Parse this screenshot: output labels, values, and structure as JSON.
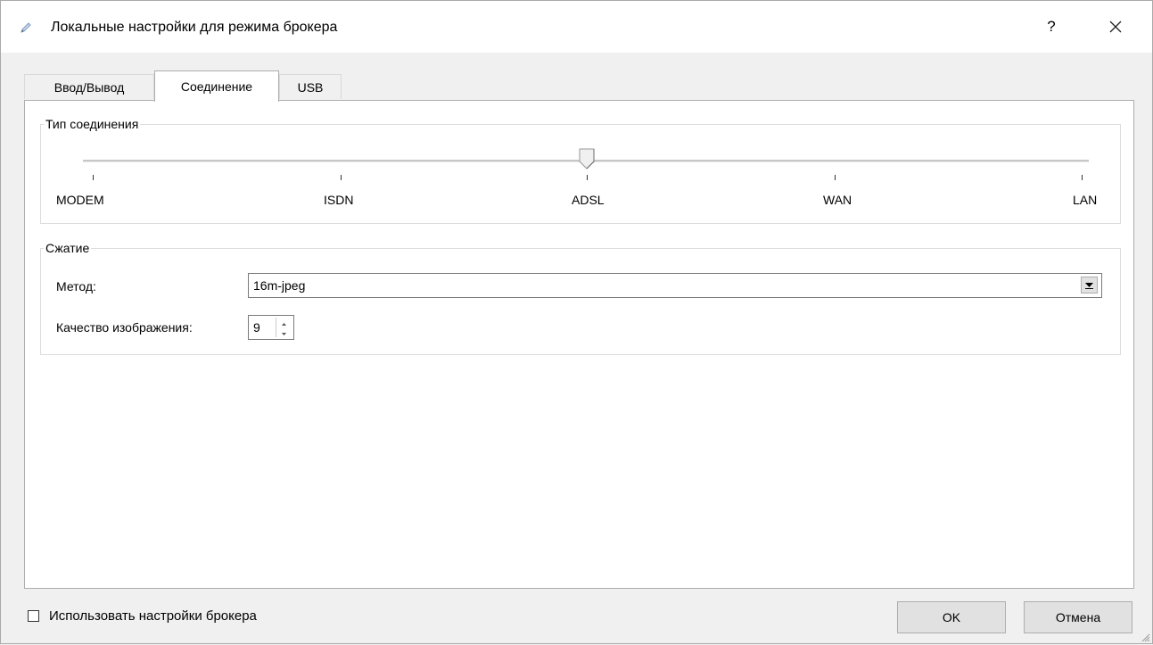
{
  "window": {
    "title": "Локальные настройки для режима брокера",
    "help_label": "?",
    "close_label": "✕"
  },
  "tabs": [
    {
      "label": "Ввод/Вывод",
      "active": false
    },
    {
      "label": "Соединение",
      "active": true
    },
    {
      "label": "USB",
      "active": false
    }
  ],
  "connection": {
    "group_title": "Тип соединения",
    "options": [
      "MODEM",
      "ISDN",
      "ADSL",
      "WAN",
      "LAN"
    ],
    "selected": "ADSL"
  },
  "compression": {
    "group_title": "Сжатие",
    "method_label": "Метод:",
    "method_value": "16m-jpeg",
    "quality_label": "Качество изображения:",
    "quality_value": "9"
  },
  "footer": {
    "checkbox_label": "Использовать настройки брокера",
    "checkbox_checked": false,
    "ok_label": "OK",
    "cancel_label": "Отмена"
  },
  "icons": {
    "app": "pencil-icon",
    "close": "close-icon",
    "combo_arrow": "chevron-down-icon",
    "spin_up": "arrow-up-icon",
    "spin_down": "arrow-down-icon",
    "grip": "resize-grip-icon"
  }
}
